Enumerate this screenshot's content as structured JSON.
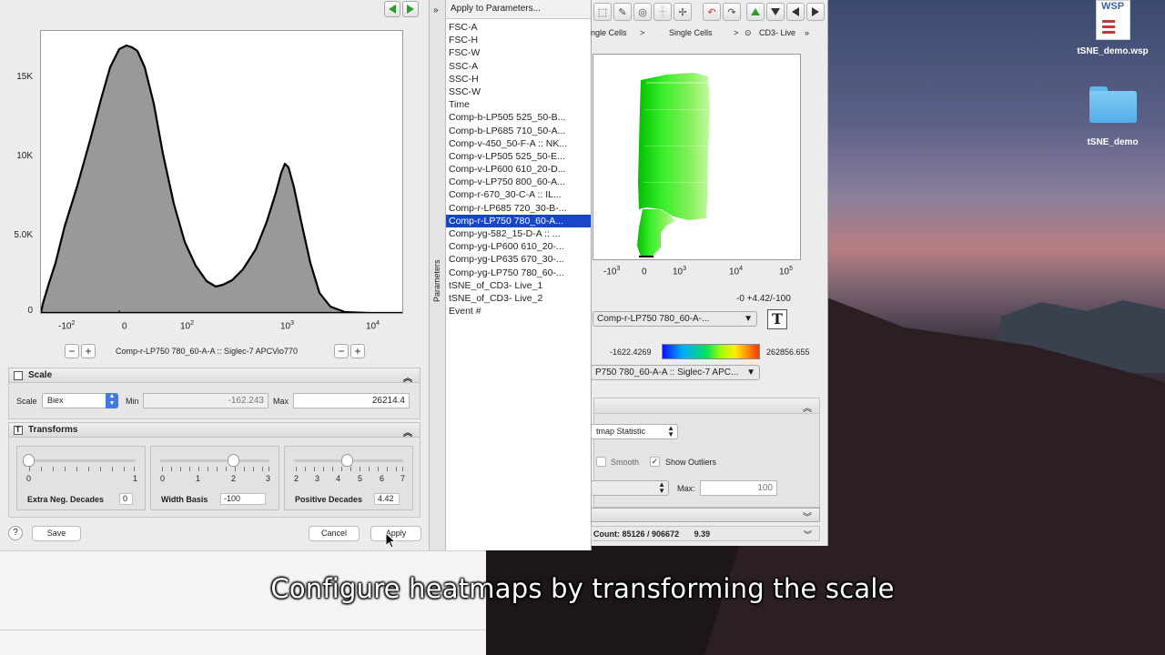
{
  "histogram": {
    "y_ticks": [
      "15K",
      "10K",
      "5.0K",
      "0"
    ],
    "x_ticks": [
      {
        "base": "-10",
        "exp": "2"
      },
      {
        "base": "0",
        "exp": ""
      },
      {
        "base": "10",
        "exp": "2"
      },
      {
        "base": "10",
        "exp": "3"
      },
      {
        "base": "10",
        "exp": "4"
      }
    ],
    "axis_parameter": "Comp-r-LP750 780_60-A-A :: Siglec-7 APCVio770",
    "minus": "−",
    "plus": "+"
  },
  "scale": {
    "header": "Scale",
    "scale_label": "Scale",
    "scale_value": "Biex",
    "min_label": "Min",
    "min_value": "-162.243",
    "max_label": "Max",
    "max_value": "26214.4"
  },
  "transforms": {
    "header": "Transforms",
    "extra_neg_decades": {
      "label": "Extra Neg. Decades",
      "value": "0",
      "ticks": [
        "0",
        "1"
      ],
      "level": 0
    },
    "width_basis": {
      "label": "Width Basis",
      "value": "-100",
      "ticks": [
        "0",
        "1",
        "2",
        "3"
      ],
      "level": 0.67
    },
    "positive_decades": {
      "label": "Positive Decades",
      "value": "4.42",
      "ticks": [
        "2",
        "3",
        "4",
        "5",
        "6",
        "7"
      ],
      "level": 0.484
    }
  },
  "buttons": {
    "help": "?",
    "save": "Save",
    "cancel": "Cancel",
    "apply": "Apply"
  },
  "parameters": {
    "strip_label": "Parameters",
    "expand_glyph": "»",
    "apply_to": "Apply to Parameters...",
    "items": [
      "FSC-A",
      "FSC-H",
      "FSC-W",
      "SSC-A",
      "SSC-H",
      "SSC-W",
      "Time",
      "Comp-b-LP505 525_50-B...",
      "Comp-b-LP685 710_50-A...",
      "Comp-v-450_50-F-A :: NK...",
      "Comp-v-LP505 525_50-E...",
      "Comp-v-LP600 610_20-D...",
      "Comp-v-LP750 800_60-A...",
      "Comp-r-670_30-C-A :: IL...",
      "Comp-r-LP685 720_30-B-...",
      "Comp-r-LP750 780_60-A...",
      "Comp-yg-582_15-D-A :: ...",
      "Comp-yg-LP600 610_20-...",
      "Comp-yg-LP635 670_30-...",
      "Comp-yg-LP750 780_60-...",
      "tSNE_of_CD3- Live_1",
      "tSNE_of_CD3- Live_2",
      "Event #"
    ],
    "selected_index": 15
  },
  "graph_window": {
    "breadcrumbs": [
      "ngle Cells",
      "Single Cells",
      "CD3- Live"
    ],
    "crumb_sep": ">",
    "overflow": "»",
    "x_ticks": [
      {
        "base": "-10",
        "exp": "3"
      },
      {
        "base": "0",
        "exp": ""
      },
      {
        "base": "10",
        "exp": "3"
      },
      {
        "base": "10",
        "exp": "4"
      },
      {
        "base": "10",
        "exp": "5"
      }
    ],
    "transform_readout": "-0 +4.42/-100",
    "x_param_dropdown": "Comp-r-LP750 780_60-A-...",
    "text_tool": "T",
    "color_min": "-1622.4269",
    "color_max": "262856.655",
    "color_param_dropdown": "P750 780_60-A-A :: Siglec-7 APC...",
    "statistic": "tmap Statistic",
    "smooth_label": "Smooth",
    "show_outliers_label": "Show Outliers",
    "check_mark": "✓",
    "max_label": "Max:",
    "max_value": "100",
    "count_label": "Count:",
    "count_value": "85126 / 906672",
    "percent": "9.39"
  },
  "desktop": {
    "file_label": "tSNE_demo.wsp",
    "file_badge": "WSP",
    "folder_label": "tSNE_demo"
  },
  "caption": "Configure heatmaps by transforming the scale",
  "colors": {
    "selection": "#1846c8",
    "histogram_fill": "#999999",
    "accent_green": "#2f9a2f"
  }
}
